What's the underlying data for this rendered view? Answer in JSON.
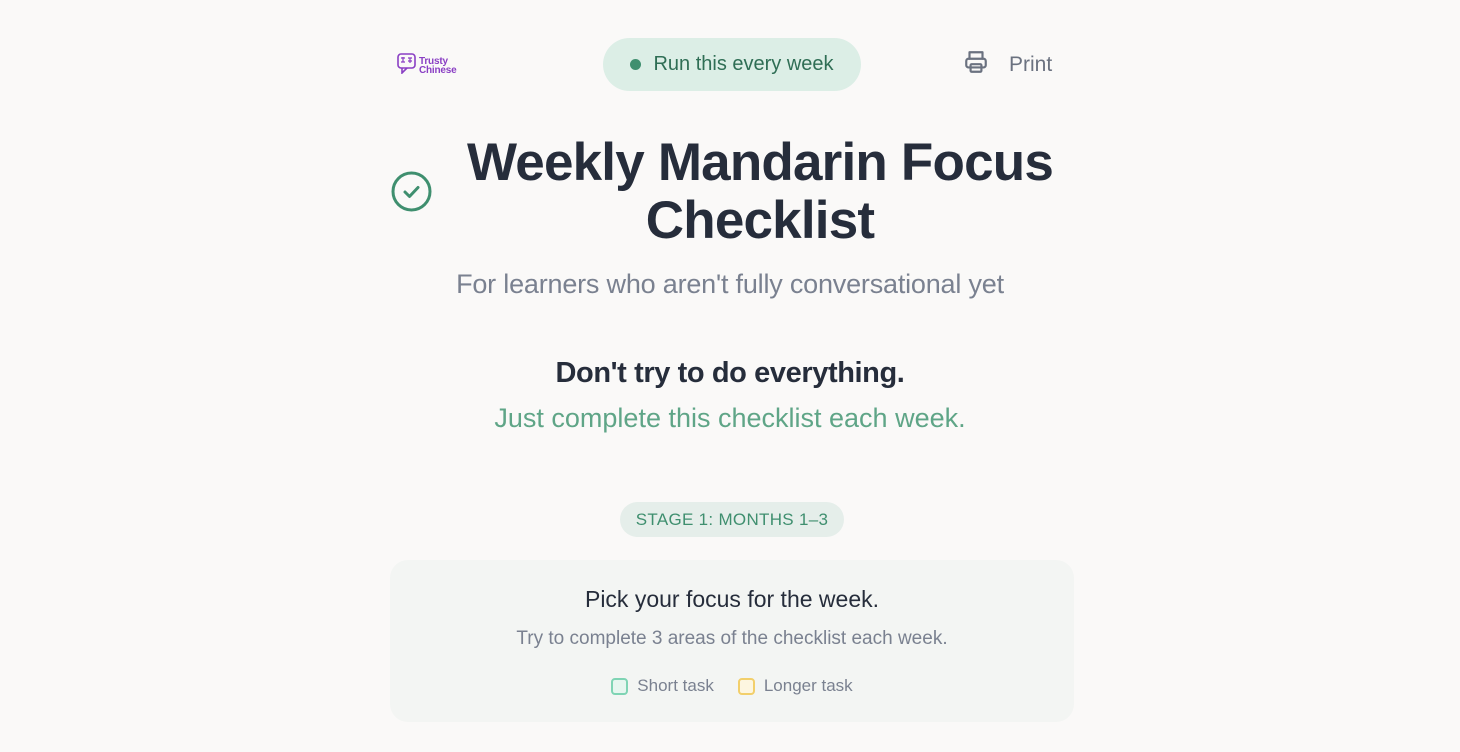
{
  "brand": {
    "name_line1": "Trusty",
    "name_line2": "Chinese",
    "logo_color": "#8a3fc4"
  },
  "header": {
    "pill_label": "Run this every week",
    "print_label": "Print"
  },
  "hero": {
    "title": "Weekly Mandarin Focus Checklist",
    "subtitle": "For learners who aren't fully conversational yet",
    "lead": "Don't try to do everything.",
    "lead_accent": "Just complete this checklist each week."
  },
  "stage": {
    "label": "STAGE 1: MONTHS 1–3"
  },
  "focus_card": {
    "title": "Pick your focus for the week.",
    "subtitle": "Try to complete 3 areas of the checklist each week.",
    "legend": [
      {
        "label": "Short task",
        "color": "#7fd4b4"
      },
      {
        "label": "Longer task",
        "color": "#f2cf6b"
      }
    ]
  },
  "colors": {
    "accent_green": "#3f8f6f",
    "accent_light_green": "#5fa587",
    "heading": "#262d3b",
    "muted": "#7a8190"
  }
}
